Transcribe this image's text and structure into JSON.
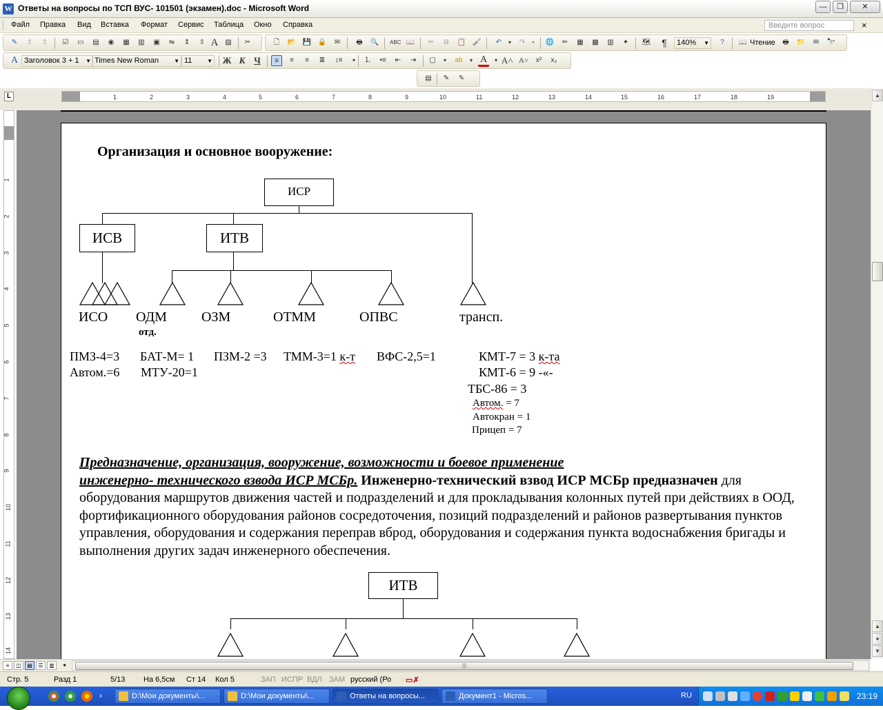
{
  "window": {
    "title": "Ответы на вопросы по ТСП ВУС- 101501 (экзамен).doc - Microsoft Word",
    "app_icon": "W",
    "minimize": "—",
    "restore": "❐",
    "close": "✕"
  },
  "menu": {
    "items": [
      "Файл",
      "Правка",
      "Вид",
      "Вставка",
      "Формат",
      "Сервис",
      "Таблица",
      "Окно",
      "Справка"
    ],
    "help_placeholder": "Введите вопрос",
    "close_doc": "×"
  },
  "toolbar": {
    "zoom": "140%",
    "reading_label": "Чтение",
    "style": "Заголовок 3 + 1",
    "font": "Times New Roman",
    "size": "11"
  },
  "ruler": {
    "h_ticks": [
      "1",
      "2",
      "3",
      "4",
      "5",
      "6",
      "7",
      "8",
      "9",
      "10",
      "11",
      "12",
      "13",
      "14",
      "15",
      "16",
      "17",
      "18",
      "19"
    ],
    "v_ticks": [
      "1",
      "2",
      "3",
      "4",
      "5",
      "6",
      "7",
      "8",
      "9",
      "10",
      "11",
      "12",
      "13",
      "14"
    ],
    "tab_selector": "L"
  },
  "doc": {
    "heading": "Организация и основное вооружение:",
    "org1": {
      "root": "ИСР",
      "isv": "ИСВ",
      "itv": "ИТВ",
      "labels": {
        "iso": "ИСО",
        "odm": "ОДМ",
        "otd": "отд.",
        "ozm": "ОЗМ",
        "otmm": "ОТММ",
        "opvs": "ОПВС",
        "transp": "трансп."
      }
    },
    "equipment": {
      "row1_a": "ПМЗ-4=3",
      "row1_b": "БАТ-М= 1",
      "row1_c": "ПЗМ-2 =3",
      "row1_d_main": "ТММ-3=1 ",
      "row1_d_sq": "к-т",
      "row1_e": "ВФС-2,5=1",
      "row1_f_main": "КМТ-7 = 3 ",
      "row1_f_sq": "к-та",
      "row2_a": "Автом.=6",
      "row2_b": "МТУ-20=1",
      "row2_f": "КМТ-6 = 9 -«-",
      "tbs": "ТБС-86 = 3",
      "avtom_sq": "Автом.",
      "avtom_val": " = 7",
      "avtokran": "Автокран = 1",
      "pricep": "Прицеп = 7"
    },
    "paragraph": {
      "head1": "Предназначение, организация, вооружение, возможности и боевое применение",
      "head2": "инженерно- технического взвода ИСР МСБр.",
      "bold_part": " Инженерно-технический взвод ИСР МСБр предназначен",
      "rest": " для оборудования маршрутов движения частей и подразделений и для прокладывания колонных путей при действиях в ООД, фортификационного оборудования районов сосредоточения, позиций подразделений и районов развертывания пунктов управления, оборудования и содержания переправ вброд, оборудования и содержания пункта водоснабжения бригады и выполнения других задач инженерного обеспечения."
    },
    "org2": {
      "root": "ИТВ"
    }
  },
  "status": {
    "page": "Стр. 5",
    "section": "Разд 1",
    "pages": "5/13",
    "at": "На 6,5см",
    "line": "Ст 14",
    "col": "Кол 5",
    "rec": "ЗАП",
    "trk": "ИСПР",
    "ext": "ВДЛ",
    "ovr": "ЗАМ",
    "lang": "русский (Ро"
  },
  "taskbar": {
    "buttons": [
      {
        "label": "D:\\Мои документы\\...",
        "active": false
      },
      {
        "label": "D:\\Мои документы\\...",
        "active": false
      },
      {
        "label": "Ответы на вопросы...",
        "active": true
      },
      {
        "label": "Документ1 - Micros...",
        "active": false
      }
    ],
    "lang": "RU",
    "clock": "23:19",
    "chevron": "›"
  }
}
